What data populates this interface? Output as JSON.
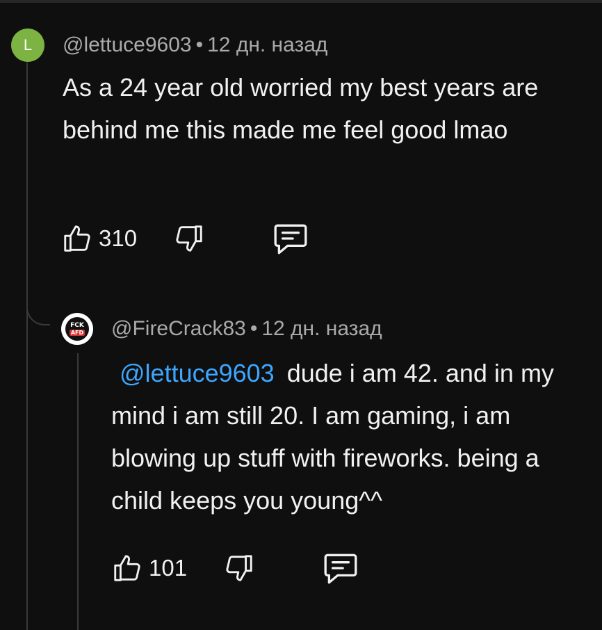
{
  "comments": [
    {
      "avatar_letter": "L",
      "avatar_color": "#7cb342",
      "author": "@lettuce9603",
      "separator": "•",
      "time": "12 дн. назад",
      "text": "As a 24 year old worried my best years are behind me this made me feel good lmao",
      "likes": "310",
      "icons": [
        "thumbs-up-icon",
        "thumbs-down-icon",
        "reply-icon"
      ]
    },
    {
      "avatar_text_top": "FCK",
      "avatar_text_bottom": "AFD",
      "author": "@FireCrack83",
      "separator": "•",
      "time": "12 дн. назад",
      "mention": "@lettuce9603",
      "text": "dude i am 42. and in my mind i am still 20. I am gaming, i am blowing up stuff with fireworks. being a child keeps you young^^",
      "likes": "101",
      "icons": [
        "thumbs-up-icon",
        "thumbs-down-icon",
        "reply-icon"
      ]
    }
  ],
  "colors": {
    "background": "#0f0f0f",
    "text": "#f1f1f1",
    "meta": "#aaaaaa",
    "mention": "#3ea6ff",
    "thread_line": "#3a3a3a"
  }
}
